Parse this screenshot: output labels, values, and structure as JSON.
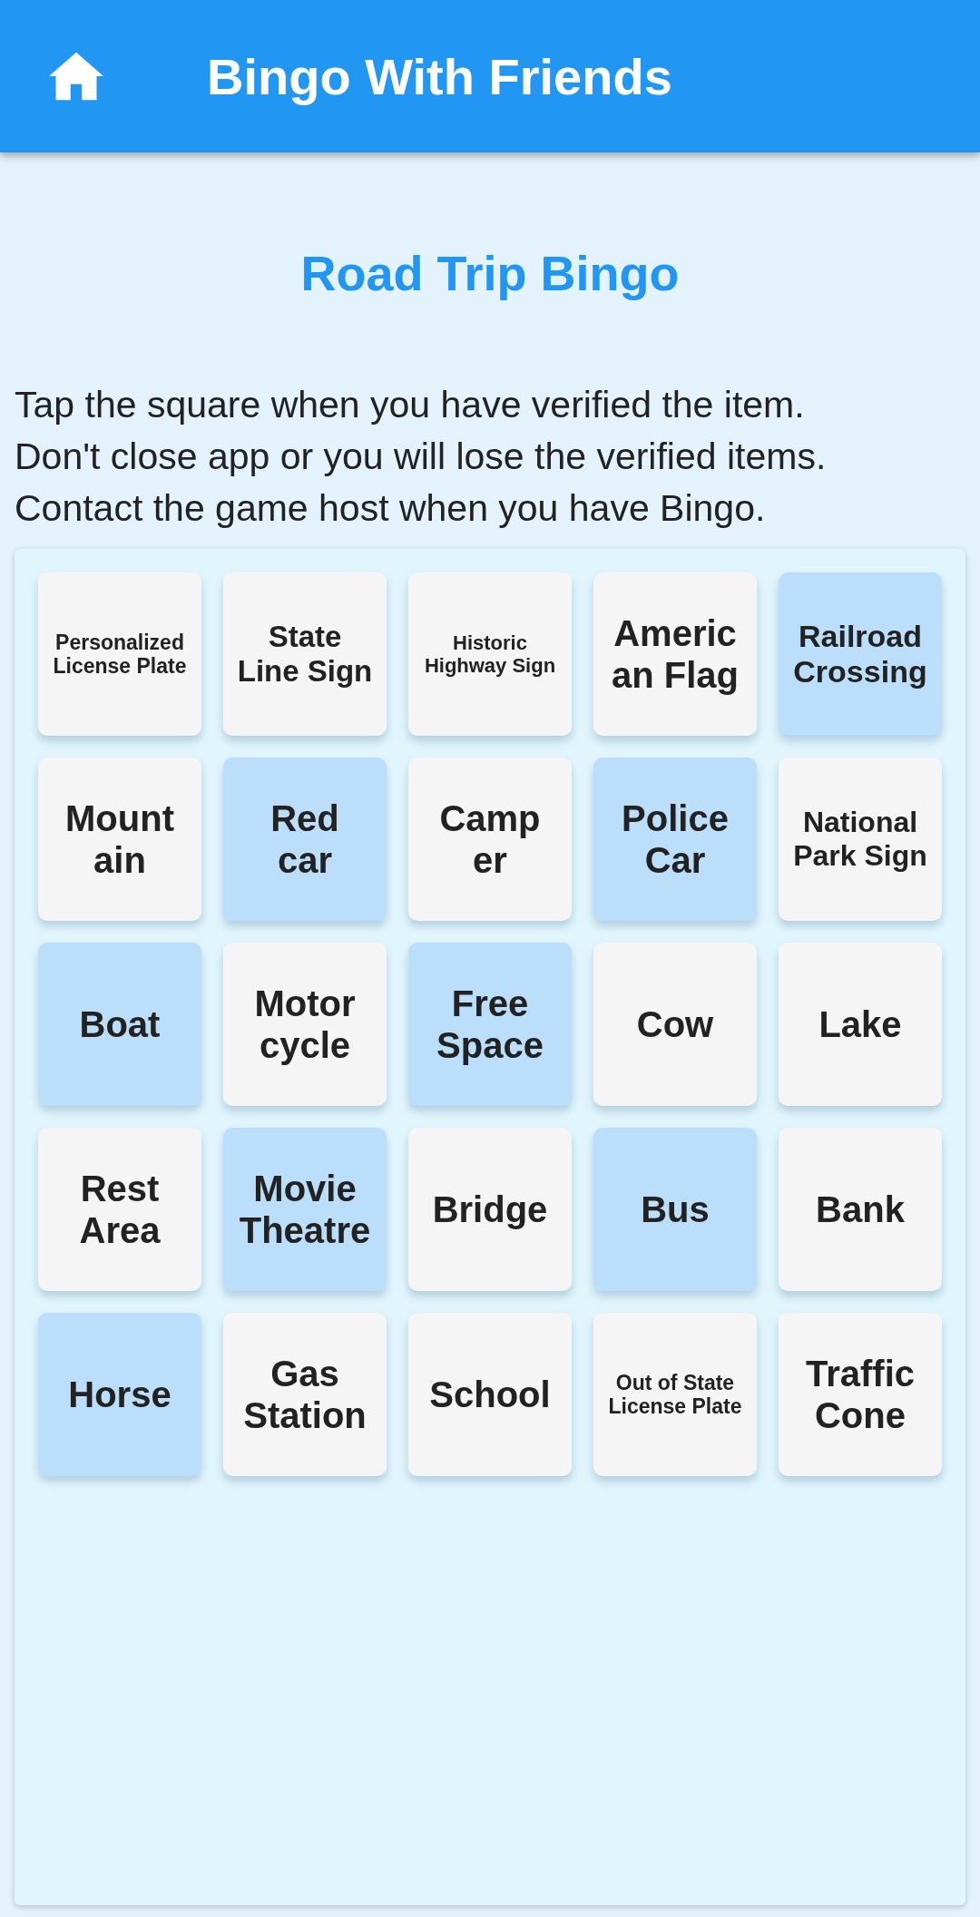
{
  "app_bar": {
    "title": "Bingo With Friends"
  },
  "heading": "Road Trip Bingo",
  "instructions": [
    "Tap the square when you have verified the item.",
    "Don't close app or you will lose the verified items.",
    "Contact the game host when you have Bingo."
  ],
  "board": {
    "squares": [
      {
        "label": "Personalized\nLicense Plate",
        "selected": false
      },
      {
        "label": "State\nLine Sign",
        "selected": false
      },
      {
        "label": "Historic\nHighway Sign",
        "selected": false
      },
      {
        "label": "Americ\nan Flag",
        "selected": false
      },
      {
        "label": "Railroad\nCrossing",
        "selected": true
      },
      {
        "label": "Mount\nain",
        "selected": false
      },
      {
        "label": "Red\ncar",
        "selected": true
      },
      {
        "label": "Camp\ner",
        "selected": false
      },
      {
        "label": "Police\nCar",
        "selected": true
      },
      {
        "label": "National\nPark Sign",
        "selected": false
      },
      {
        "label": "Boat",
        "selected": true
      },
      {
        "label": "Motor\ncycle",
        "selected": false
      },
      {
        "label": "Free\nSpace",
        "selected": true
      },
      {
        "label": "Cow",
        "selected": false
      },
      {
        "label": "Lake",
        "selected": false
      },
      {
        "label": "Rest\nArea",
        "selected": false
      },
      {
        "label": "Movie\nTheatre",
        "selected": true
      },
      {
        "label": "Bridge",
        "selected": false
      },
      {
        "label": "Bus",
        "selected": true
      },
      {
        "label": "Bank",
        "selected": false
      },
      {
        "label": "Horse",
        "selected": true
      },
      {
        "label": "Gas\nStation",
        "selected": false
      },
      {
        "label": "School",
        "selected": false
      },
      {
        "label": "Out of State\nLicense Plate",
        "selected": false
      },
      {
        "label": "Traffic\nCone",
        "selected": false
      }
    ]
  }
}
